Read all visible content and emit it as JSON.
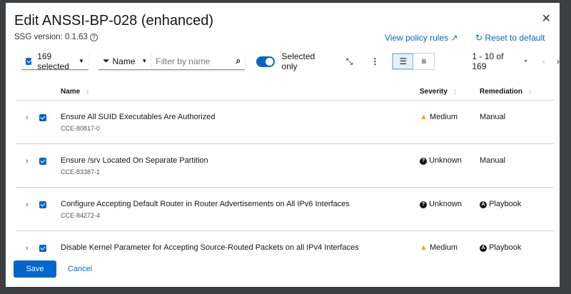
{
  "modal": {
    "title": "Edit ANSSI-BP-028 (enhanced)",
    "ssg_version": "SSG version: 0.1.63",
    "view_policy_rules": "View policy rules",
    "reset_to_default": "Reset to default"
  },
  "toolbar": {
    "selected": "169 selected",
    "filter_attr": "Name",
    "filter_placeholder": "Filter by name",
    "selected_only": "Selected only",
    "pagination": "1 - 10 of 169"
  },
  "table": {
    "headers": {
      "name": "Name",
      "severity": "Severity",
      "remediation": "Remediation"
    },
    "rows": [
      {
        "name": "Ensure All SUID Executables Are Authorized",
        "cce": "CCE-80817-0",
        "severity": "Medium",
        "severity_icon": "warning-icon",
        "remediation": "Manual"
      },
      {
        "name": "Ensure /srv Located On Separate Partition",
        "cce": "CCE-83387-1",
        "severity": "Unknown",
        "severity_icon": "question-circle-icon",
        "remediation": "Manual"
      },
      {
        "name": "Configure Accepting Default Router in Router Advertisements on All IPv6 Interfaces",
        "cce": "CCE-84272-4",
        "severity": "Unknown",
        "severity_icon": "question-circle-icon",
        "remediation": "Playbook"
      },
      {
        "name": "Disable Kernel Parameter for Accepting Source-Routed Packets on all IPv4 Interfaces",
        "cce": "",
        "severity": "Medium",
        "severity_icon": "warning-icon",
        "remediation": "Playbook"
      }
    ]
  },
  "footer": {
    "save": "Save",
    "cancel": "Cancel"
  }
}
